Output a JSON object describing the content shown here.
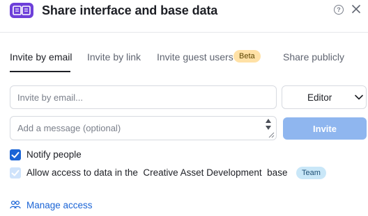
{
  "header": {
    "title": "Share interface and base data",
    "help_glyph": "?",
    "icons": {
      "app": "open-book-icon",
      "help": "question-mark-icon",
      "close": "close-icon"
    }
  },
  "tabs": [
    {
      "label": "Invite by email",
      "active": true
    },
    {
      "label": "Invite by link",
      "active": false
    },
    {
      "label": "Invite guest users",
      "active": false,
      "badge": "Beta"
    },
    {
      "label": "Share publicly",
      "active": false
    }
  ],
  "invite_form": {
    "email_placeholder": "Invite by email...",
    "email_value": "",
    "role_value": "Editor",
    "message_placeholder": "Add a message (optional)",
    "message_value": "",
    "invite_label": "Invite"
  },
  "options": {
    "notify": {
      "label": "Notify people",
      "checked": true
    },
    "allow_access": {
      "label": "Allow access to data in the  Creative Asset Development  base",
      "checked": true,
      "disabled": true,
      "badge": "Team"
    }
  },
  "manage_access": {
    "label": "Manage access",
    "icon": "people-icon"
  },
  "colors": {
    "accent_blue": "#1a64d6",
    "invite_button_disabled": "#8fb6ef",
    "app_icon_purple": "#6d3fd9",
    "beta_badge_bg": "#ffe1a6",
    "team_badge_bg": "#c9e7f8"
  }
}
